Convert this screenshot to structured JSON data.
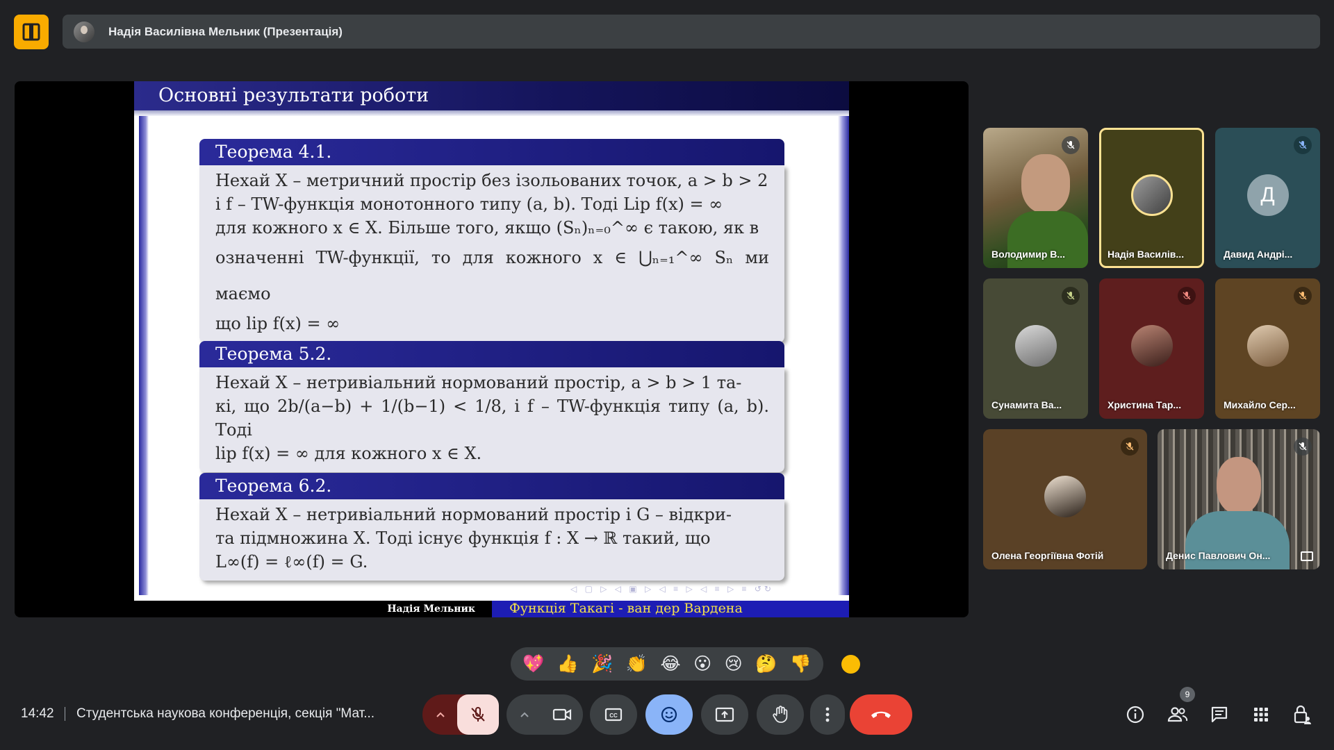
{
  "header": {
    "presenter_title": "Надія Василівна Мельник (Презентація)"
  },
  "slide": {
    "title": "Основні результати роботи",
    "theorems": [
      {
        "title": "Теорема 4.1.",
        "lines": [
          "Нехай X – метричний простір без ізольованих точок, a > b > 2",
          "і f – TW-функція монотонного типу (a, b). Тоді Lip f(x) = ∞",
          "для кожного x ∈ X. Більше того, якщо (Sₙ)ₙ₌₀^∞ є такою, як в",
          "означенні TW-функції, то для кожного x ∈ ⋃ₙ₌₁^∞ Sₙ ми маємо",
          "що lip f(x) = ∞"
        ]
      },
      {
        "title": "Теорема 5.2.",
        "lines": [
          "Нехай X – нетривіальний нормований простір, a > b > 1 та-",
          "кі, що 2b/(a−b) + 1/(b−1) < 1/8, і f – TW-функція типу (a, b). Тоді",
          "lip f(x) = ∞ для кожного x ∈ X."
        ]
      },
      {
        "title": "Теорема 6.2.",
        "lines": [
          "Нехай X – нетривіальний нормований простір і G – відкри-",
          "та підмножина X. Тоді існує функція f : X → ℝ такий, що",
          "L∞(f) = ℓ∞(f) = G."
        ]
      }
    ],
    "footer_author": "Надія Мельник",
    "footer_title": "Функція Такагі - ван дер Вардена"
  },
  "participants": [
    {
      "name": "Володимир В...",
      "mic": "muted",
      "type": "video"
    },
    {
      "name": "Надія Василів...",
      "mic": "speaking",
      "type": "avatar"
    },
    {
      "name": "Давид Андрі...",
      "mic": "muted",
      "type": "letter",
      "letter": "Д"
    },
    {
      "name": "Сунамита Ва...",
      "mic": "muted",
      "type": "avatar"
    },
    {
      "name": "Христина Тар...",
      "mic": "muted",
      "type": "avatar"
    },
    {
      "name": "Михайло Сер...",
      "mic": "muted",
      "type": "avatar"
    },
    {
      "name": "Олена Георгіївна Фотій",
      "mic": "muted",
      "type": "avatar"
    },
    {
      "name": "Денис Павлович Он...",
      "mic": "muted",
      "type": "video"
    }
  ],
  "reactions": [
    "💖",
    "👍",
    "🎉",
    "👏",
    "😂",
    "😮",
    "😢",
    "🤔",
    "👎"
  ],
  "bottom_bar": {
    "time": "14:42",
    "meeting_title": "Студентська наукова конференція, секція \"Мат...",
    "participants_count": "9"
  },
  "colors": {
    "background": "#202124",
    "surface": "#3c4043",
    "accent": "#8ab4f8",
    "leave": "#ea4335",
    "logo": "#f9ab00"
  }
}
